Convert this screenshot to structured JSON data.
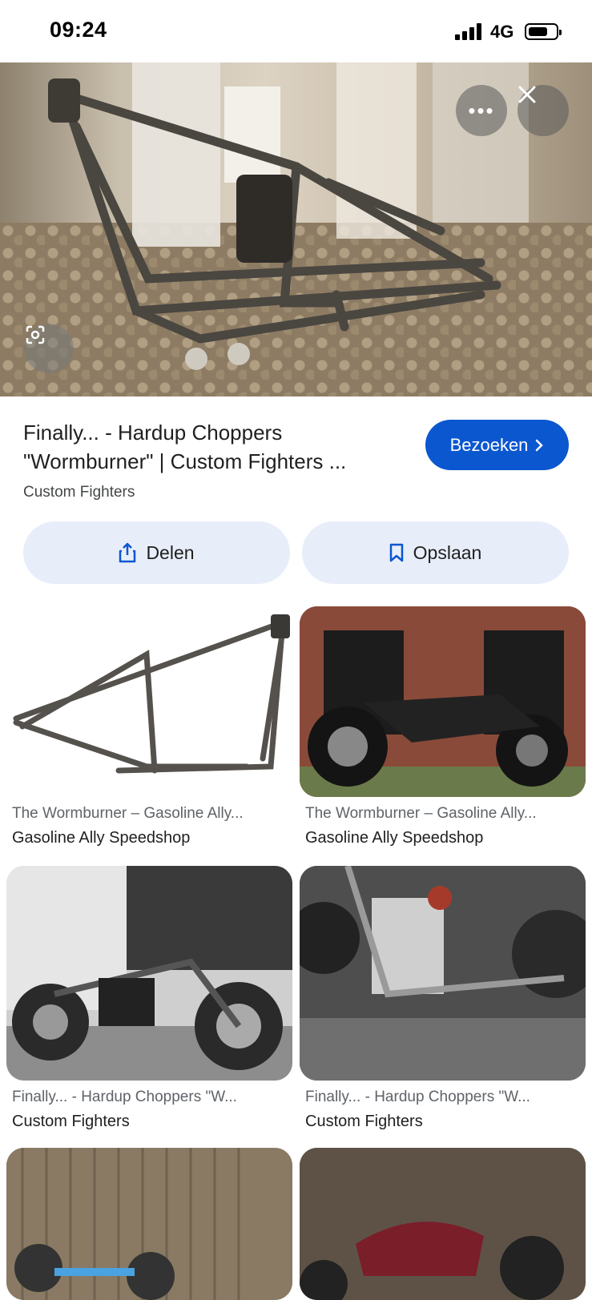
{
  "status_bar": {
    "time": "09:24",
    "network": "4G"
  },
  "hero": {
    "alt": "motorcycle frame"
  },
  "result": {
    "title": "Finally... - Hardup Choppers \"Wormburner\" | Custom Fighters ...",
    "source": "Custom Fighters",
    "visit_label": "Bezoeken",
    "share_label": "Delen",
    "save_label": "Opslaan"
  },
  "grid": [
    {
      "caption": "The Wormburner – Gasoline Ally...",
      "site": "Gasoline Ally Speedshop"
    },
    {
      "caption": "The Wormburner – Gasoline Ally...",
      "site": "Gasoline Ally Speedshop"
    },
    {
      "caption": "Finally... - Hardup Choppers \"W...",
      "site": "Custom Fighters"
    },
    {
      "caption": "Finally... - Hardup Choppers \"W...",
      "site": "Custom Fighters"
    }
  ],
  "colors": {
    "primary": "#0b57d0",
    "pill_bg": "#e8eef9"
  }
}
